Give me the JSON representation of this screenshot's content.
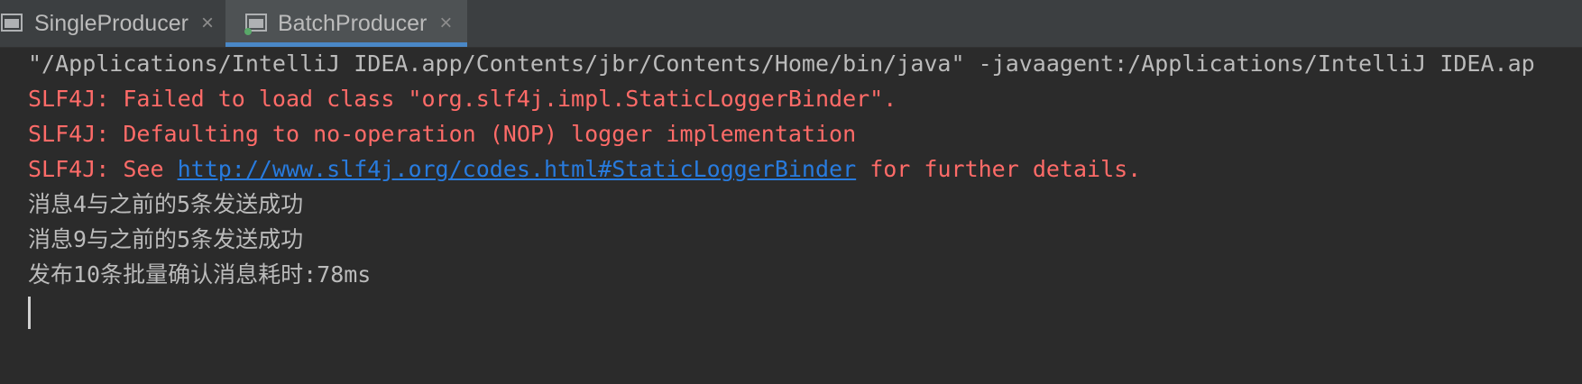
{
  "tabs": [
    {
      "label": "SingleProducer",
      "active": false
    },
    {
      "label": "BatchProducer",
      "active": true
    }
  ],
  "console": {
    "command_line": "\"/Applications/IntelliJ IDEA.app/Contents/jbr/Contents/Home/bin/java\" -javaagent:/Applications/IntelliJ IDEA.ap",
    "warn1": "SLF4J: Failed to load class \"org.slf4j.impl.StaticLoggerBinder\".",
    "warn2": "SLF4J: Defaulting to no-operation (NOP) logger implementation",
    "warn3_prefix": "SLF4J: See ",
    "warn3_link": "http://www.slf4j.org/codes.html#StaticLoggerBinder",
    "warn3_suffix": " for further details.",
    "out1": "消息4与之前的5条发送成功",
    "out2": "消息9与之前的5条发送成功",
    "out3": "发布10条批量确认消息耗时:78ms"
  },
  "colors": {
    "background": "#2b2b2b",
    "default_text": "#bbbbbb",
    "error_text": "#ff6b68",
    "link": "#287bde",
    "active_tab_underline": "#4a88c7"
  },
  "icons": {
    "tab_icon": "run-console-icon",
    "close": "close-icon"
  }
}
